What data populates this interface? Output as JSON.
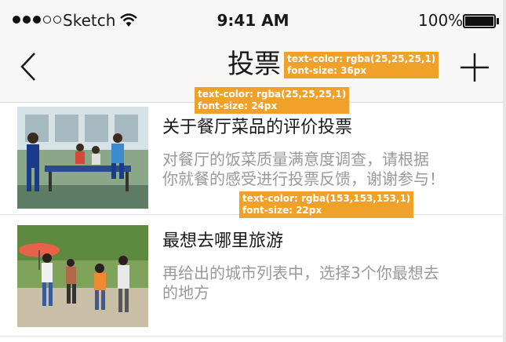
{
  "status_bar": {
    "carrier": "Sketch",
    "time": "9:41 AM",
    "battery": "100%"
  },
  "nav": {
    "title": "投票"
  },
  "annotations": {
    "title_tip": [
      "text-color: rgba(25,25,25,1)",
      "font-size: 36px"
    ],
    "item_title_tip": [
      "text-color: rgba(25,25,25,1)",
      "font-size: 24px"
    ],
    "item_desc_tip": [
      "text-color: rgba(153,153,153,1)",
      "font-size: 22px"
    ]
  },
  "items": [
    {
      "title": "关于餐厅菜品的评价投票",
      "desc_line1": "对餐厅的饭菜质量满意度调查，请根据",
      "desc_line2": "你就餐的感受进行投票反馈，谢谢参与！"
    },
    {
      "title": "最想去哪里旅游",
      "desc_line1": "再给出的城市列表中，选择3个你最想去",
      "desc_line2": "的地方"
    }
  ],
  "colors": {
    "accent": "#f0a12a",
    "title_text": "#191919",
    "desc_text": "#999999",
    "bar_bg": "#f7f7f7"
  }
}
